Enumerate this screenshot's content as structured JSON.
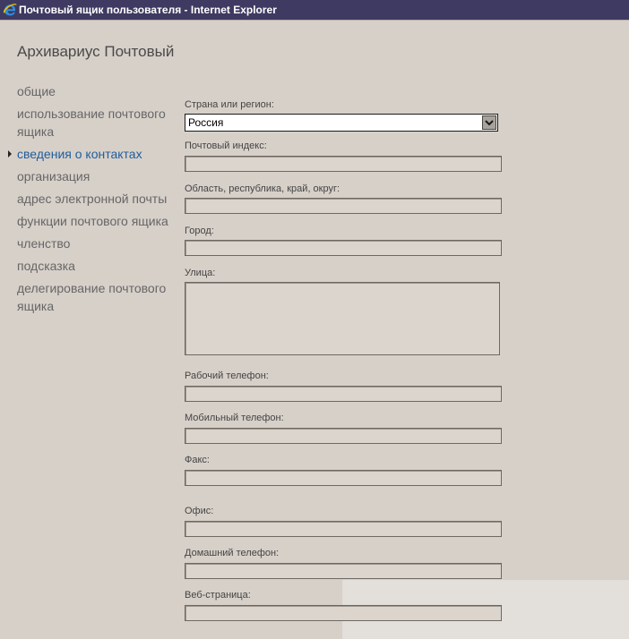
{
  "window": {
    "title": "Почтовый ящик пользователя - Internet Explorer"
  },
  "page": {
    "title": "Архивариус Почтовый"
  },
  "nav": {
    "items": [
      {
        "label": "общие"
      },
      {
        "label": "использование почтового ящика"
      },
      {
        "label": "сведения о контактах",
        "active": true
      },
      {
        "label": "организация"
      },
      {
        "label": "адрес электронной почты"
      },
      {
        "label": "функции почтового ящика"
      },
      {
        "label": "членство"
      },
      {
        "label": "подсказка"
      },
      {
        "label": "делегирование почтового ящика"
      }
    ]
  },
  "form": {
    "country": {
      "label": "Страна или регион:",
      "value": "Россия"
    },
    "postal_code": {
      "label": "Почтовый индекс:",
      "value": ""
    },
    "region": {
      "label": "Область, республика, край, округ:",
      "value": ""
    },
    "city": {
      "label": "Город:",
      "value": ""
    },
    "street": {
      "label": "Улица:",
      "value": ""
    },
    "work_phone": {
      "label": "Рабочий телефон:",
      "value": ""
    },
    "mobile_phone": {
      "label": "Мобильный телефон:",
      "value": ""
    },
    "fax": {
      "label": "Факс:",
      "value": ""
    },
    "office": {
      "label": "Офис:",
      "value": ""
    },
    "home_phone": {
      "label": "Домашний телефон:",
      "value": ""
    },
    "web_page": {
      "label": "Веб-страница:",
      "value": ""
    }
  },
  "colors": {
    "titlebar": "#3f3a62",
    "background": "#d7d0c9",
    "active_nav": "#1f5d9c"
  },
  "icons": {
    "window": "internet-explorer-icon",
    "dropdown": "chevron-down-icon",
    "active_marker": "triangle-right-icon"
  }
}
